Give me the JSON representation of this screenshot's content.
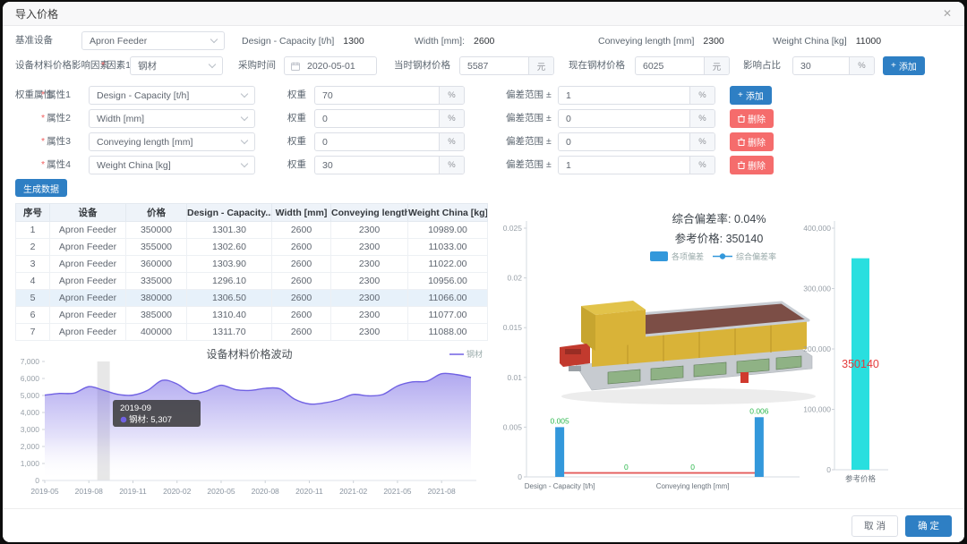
{
  "dialog": {
    "title": "导入价格",
    "close": "✕"
  },
  "base_equipment": {
    "label": "基准设备",
    "value": "Apron Feeder",
    "specs": [
      {
        "label": "Design - Capacity [t/h]",
        "value": "1300"
      },
      {
        "label": "Width [mm]:",
        "value": "2600"
      },
      {
        "label": "Conveying length [mm]",
        "value": "2300"
      },
      {
        "label": "Weight China [kg]",
        "value": "11000"
      }
    ]
  },
  "factor_row": {
    "section_label": "设备材料价格影响因素",
    "factor_label": "因素1",
    "factor_value": "钢材",
    "purchase_time_label": "采购时间",
    "purchase_time_value": "2020-05-01",
    "then_price_label": "当时钢材价格",
    "then_price_value": "5587",
    "now_price_label": "现在钢材价格",
    "now_price_value": "6025",
    "impact_label": "影响占比",
    "impact_value": "30",
    "unit_yuan": "元",
    "unit_percent": "%",
    "add_button": "添加"
  },
  "weight_section": {
    "section_label": "权重属性",
    "weight_label": "权重",
    "deviation_label": "偏差范围",
    "plusminus": "±",
    "unit_percent": "%",
    "add_button": "添加",
    "delete_button": "删除",
    "rows": [
      {
        "attr_label": "属性1",
        "attr_value": "Design - Capacity [t/h]",
        "weight": "70",
        "deviation": "1",
        "action": "add"
      },
      {
        "attr_label": "属性2",
        "attr_value": "Width [mm]",
        "weight": "0",
        "deviation": "0",
        "action": "delete"
      },
      {
        "attr_label": "属性3",
        "attr_value": "Conveying length [mm]",
        "weight": "0",
        "deviation": "0",
        "action": "delete"
      },
      {
        "attr_label": "属性4",
        "attr_value": "Weight China [kg]",
        "weight": "30",
        "deviation": "1",
        "action": "delete"
      }
    ]
  },
  "generate_button": "生成数据",
  "table": {
    "headers": [
      "序号",
      "设备",
      "价格",
      "Design - Capacity...",
      "Width [mm]",
      "Conveying length...",
      "Weight China [kg]"
    ],
    "rows": [
      [
        "1",
        "Apron Feeder",
        "350000",
        "1301.30",
        "2600",
        "2300",
        "10989.00"
      ],
      [
        "2",
        "Apron Feeder",
        "355000",
        "1302.60",
        "2600",
        "2300",
        "11033.00"
      ],
      [
        "3",
        "Apron Feeder",
        "360000",
        "1303.90",
        "2600",
        "2300",
        "11022.00"
      ],
      [
        "4",
        "Apron Feeder",
        "335000",
        "1296.10",
        "2600",
        "2300",
        "10956.00"
      ],
      [
        "5",
        "Apron Feeder",
        "380000",
        "1306.50",
        "2600",
        "2300",
        "11066.00"
      ],
      [
        "6",
        "Apron Feeder",
        "385000",
        "1310.40",
        "2600",
        "2300",
        "11077.00"
      ],
      [
        "7",
        "Apron Feeder",
        "400000",
        "1311.70",
        "2600",
        "2300",
        "11088.00"
      ]
    ],
    "selected_row_index": 4
  },
  "footer": {
    "cancel": "取 消",
    "confirm": "确 定"
  },
  "colors": {
    "accent_blue": "#2e7fc4",
    "danger_red": "#f56c6c",
    "line_purple": "#7061e3",
    "bar_blue": "#3398db",
    "dev_line_red": "#e45b5b",
    "label_green": "#2db84d",
    "price_cyan": "#29dfdf",
    "price_label_red": "#e43c3c"
  },
  "chart_data": [
    {
      "type": "area",
      "title": "设备材料价格波动",
      "legend": [
        "钢材"
      ],
      "color": "#7061e3",
      "x": [
        "2019-05",
        "2019-06",
        "2019-07",
        "2019-08",
        "2019-09",
        "2019-10",
        "2019-11",
        "2019-12",
        "2020-01",
        "2020-02",
        "2020-03",
        "2020-04",
        "2020-05",
        "2020-06",
        "2020-07",
        "2020-08",
        "2020-09",
        "2020-10",
        "2020-11",
        "2020-12",
        "2021-01",
        "2021-02",
        "2021-03",
        "2021-04",
        "2021-05",
        "2021-06",
        "2021-07",
        "2021-08",
        "2021-09",
        "2021-10"
      ],
      "values": [
        5020,
        5120,
        5140,
        5520,
        5307,
        5060,
        5020,
        5300,
        5890,
        5680,
        5140,
        5260,
        5600,
        5340,
        5300,
        5420,
        5390,
        4780,
        4500,
        4560,
        4750,
        5060,
        4980,
        5060,
        5560,
        5800,
        5840,
        6280,
        6230,
        6060
      ],
      "ylim": [
        0,
        7000
      ],
      "ytick_step": 1000,
      "xlabel_every": 3,
      "highlight_index": 4,
      "tooltip": {
        "title": "2019-09",
        "series": "钢材",
        "value": "5,307"
      }
    },
    {
      "type": "bar+line",
      "title_line1": "综合偏差率:  0.04%",
      "title_line2": "参考价格:  350140",
      "legend": [
        {
          "label": "各项偏差",
          "kind": "bar",
          "color": "#3398db"
        },
        {
          "label": "综合偏差率",
          "kind": "line",
          "color": "#3398db"
        }
      ],
      "categories": [
        "Design - Capacity [t/h]",
        "Width [mm]",
        "Conveying length [mm]",
        "Weight China [kg]"
      ],
      "bar_values": [
        0.005,
        0,
        0,
        0.006
      ],
      "bar_labels": [
        "0.005",
        "0",
        "0",
        "0.006"
      ],
      "line_values": [
        0.0004,
        0.0004,
        0.0004,
        0.0004
      ],
      "bar_color": "#3398db",
      "line_color": "#e45b5b",
      "label_color": "#2db84d",
      "ylim": [
        0,
        0.025
      ],
      "ytick_step": 0.005,
      "xlabels_shown": [
        0,
        2
      ]
    },
    {
      "type": "bar",
      "categories": [
        "参考价格"
      ],
      "values": [
        350140
      ],
      "value_label": "350140",
      "bar_color": "#29dfdf",
      "value_label_color": "#e43c3c",
      "ylim": [
        0,
        400000
      ],
      "ytick_step": 100000
    }
  ]
}
